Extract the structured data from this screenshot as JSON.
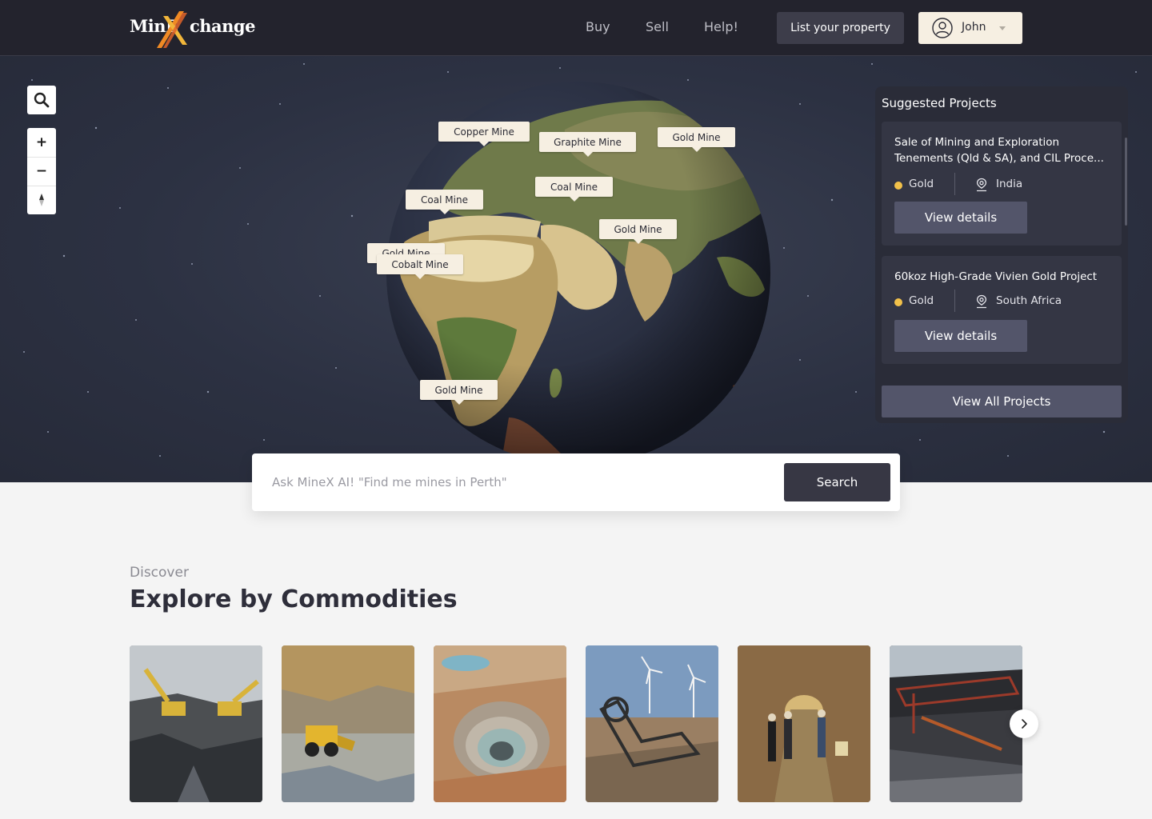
{
  "brand": {
    "name_part1": "MinE",
    "name_part2": "change",
    "accent": "#f08a24"
  },
  "header": {
    "nav": [
      {
        "label": "Buy"
      },
      {
        "label": "Sell"
      },
      {
        "label": "Help!"
      }
    ],
    "list_property": "List your property",
    "user": {
      "name": "John"
    }
  },
  "map": {
    "controls": {
      "search_icon": "search-icon",
      "zoom_in": "+",
      "zoom_out": "−",
      "compass_icon": "compass-icon"
    },
    "pins": [
      {
        "label": "Copper Mine"
      },
      {
        "label": "Graphite Mine"
      },
      {
        "label": "Gold Mine"
      },
      {
        "label": "Coal Mine"
      },
      {
        "label": "Coal Mine"
      },
      {
        "label": "Gold Mine"
      },
      {
        "label": "Gold Mine"
      },
      {
        "label": "Cobalt Mine"
      },
      {
        "label": "Gold Mine"
      }
    ]
  },
  "suggested": {
    "title": "Suggested Projects",
    "projects": [
      {
        "title": "Sale of Mining and Exploration Tenements (Qld & SA), and CIL Proce...",
        "commodity": "Gold",
        "country": "India",
        "button": "View details"
      },
      {
        "title": "60koz High-Grade Vivien Gold Project",
        "commodity": "Gold",
        "country": "South Africa",
        "button": "View details"
      }
    ],
    "view_all": "View All Projects"
  },
  "search": {
    "placeholder": "Ask MineX AI! \"Find me mines in Perth\"",
    "button": "Search"
  },
  "discover": {
    "label": "Discover",
    "title": "Explore by Commodities",
    "tiles": [
      {
        "name": "excavators-quarry-image"
      },
      {
        "name": "loader-quarry-image"
      },
      {
        "name": "open-pit-aerial-image"
      },
      {
        "name": "bucket-wheel-wind-turbines-image"
      },
      {
        "name": "underground-tunnel-image"
      },
      {
        "name": "coal-excavator-image"
      }
    ]
  }
}
